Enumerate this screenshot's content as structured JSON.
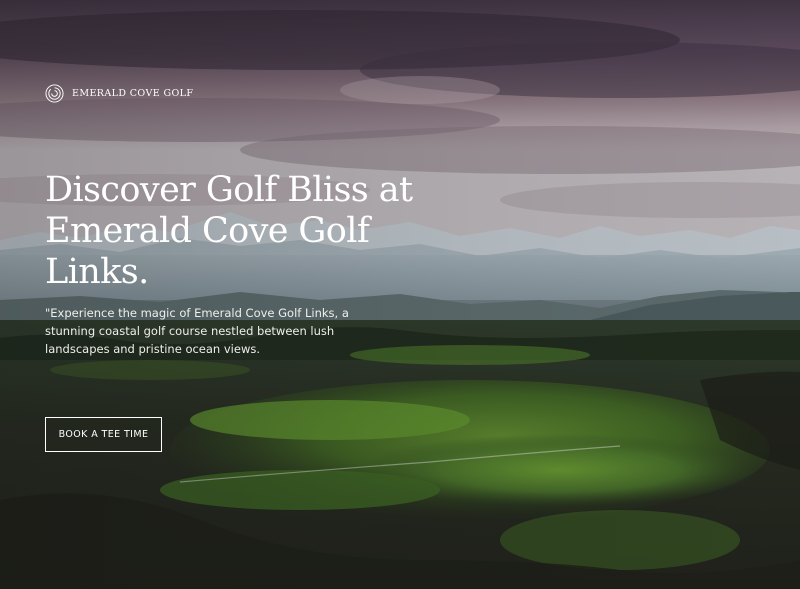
{
  "brand": {
    "name": "EMERALD COVE GOLF",
    "icon": "spiral-logo-icon"
  },
  "hero": {
    "headline": "Discover Golf Bliss at Emerald Cove Golf Links.",
    "tagline": "\"Experience the magic of Emerald Cove Golf Links, a stunning coastal golf course nestled between lush landscapes and pristine ocean views.",
    "cta_label": "BOOK A TEE TIME"
  },
  "colors": {
    "text": "#ffffff",
    "sky_top": "#4a3b4e",
    "sky_mid": "#8a7580",
    "mountains": "#8d9ca3",
    "grass": "#2f4a1e",
    "dark_ground": "#23231c"
  }
}
